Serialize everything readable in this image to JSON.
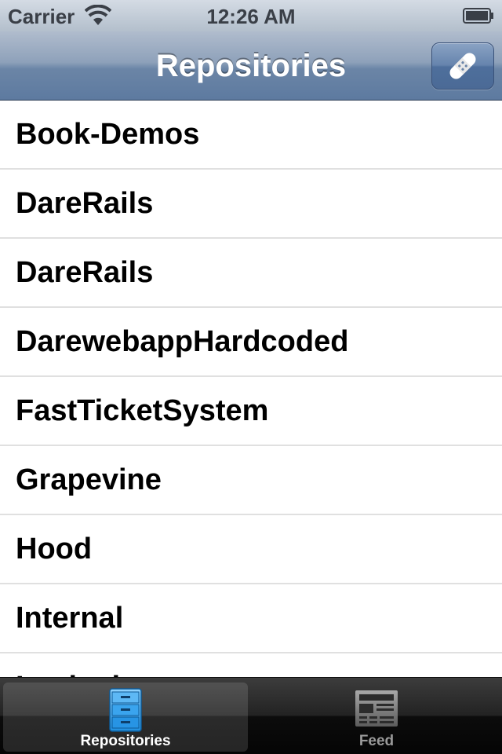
{
  "status_bar": {
    "carrier": "Carrier",
    "time": "12:26 AM",
    "wifi_icon": "wifi-icon",
    "battery_icon": "battery-icon"
  },
  "nav_bar": {
    "title": "Repositories",
    "right_button_icon": "bandage-icon",
    "tint_color": "#5d7aa0"
  },
  "repositories": [
    "Book-Demos",
    "DareRails",
    "DareRails",
    "DarewebappHardcoded",
    "FastTicketSystem",
    "Grapevine",
    "Hood",
    "Internal",
    "Locked"
  ],
  "tab_bar": {
    "tabs": [
      {
        "label": "Repositories",
        "icon": "file-cabinet-icon",
        "selected": true
      },
      {
        "label": "Feed",
        "icon": "newspaper-icon",
        "selected": false
      }
    ]
  }
}
